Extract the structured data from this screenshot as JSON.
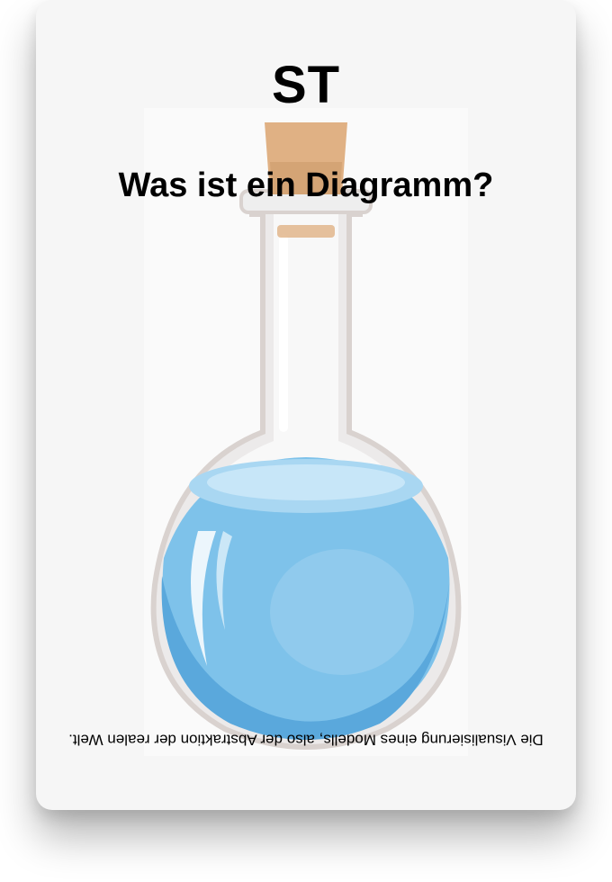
{
  "card": {
    "badge": "ST",
    "question": "Was ist ein Diagramm?",
    "answer": "Die Visualisierung eines Modells, also der Abstraktion der realen Welt."
  },
  "illustration": {
    "icon": "flask-icon",
    "colors": {
      "liquid": "#7ec2ea",
      "liquid_dark": "#5aa8dc",
      "cork": "#e0b184",
      "glass_outline": "#d9d2cf"
    }
  }
}
